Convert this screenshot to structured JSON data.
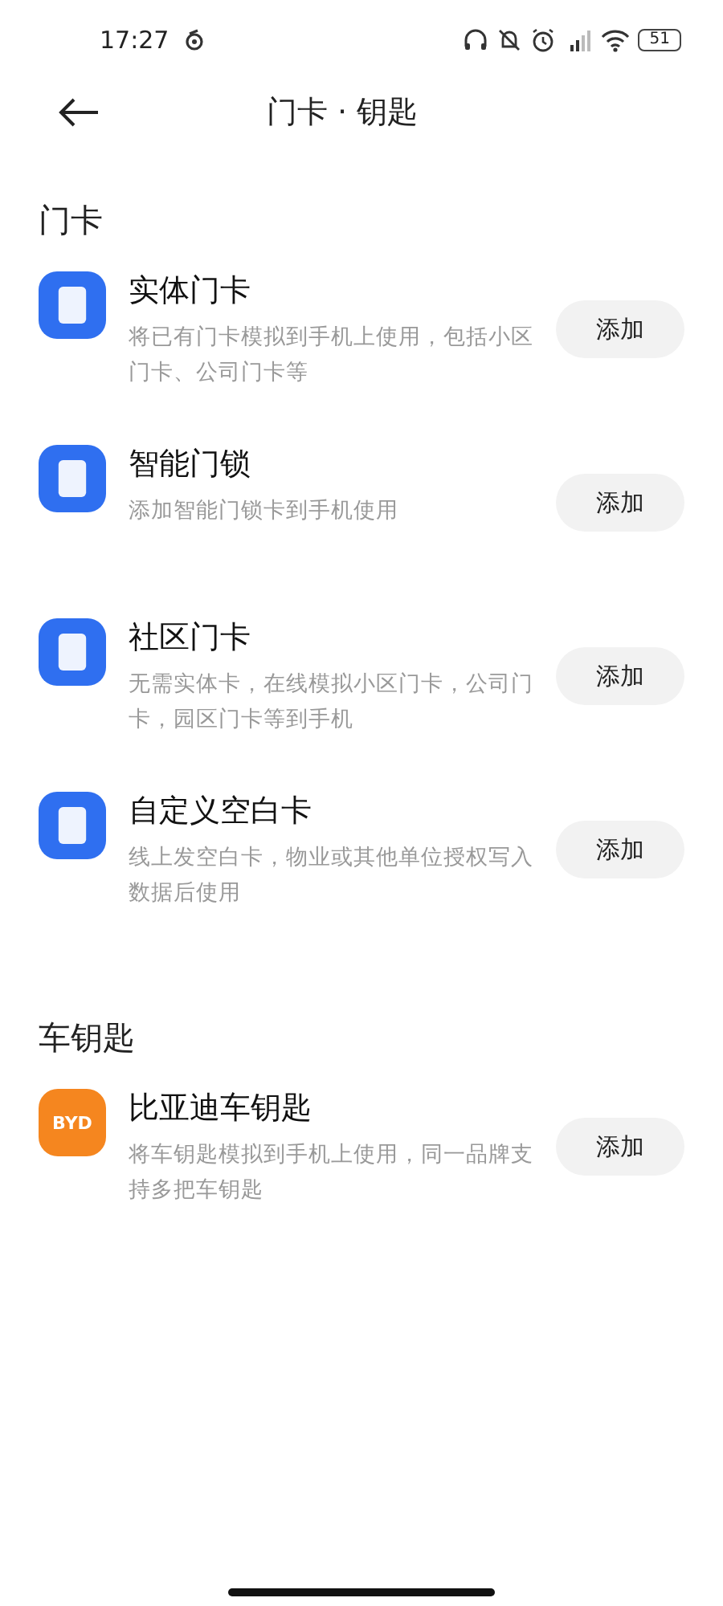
{
  "status_bar": {
    "time": "17:27",
    "battery": "51"
  },
  "header": {
    "title": "门卡 · 钥匙"
  },
  "sections": [
    {
      "title": "门卡",
      "items": [
        {
          "kind": "card",
          "name": "实体门卡",
          "description": "将已有门卡模拟到手机上使用，包括小区门卡、公司门卡等",
          "button": "添加"
        },
        {
          "kind": "card",
          "name": "智能门锁",
          "description": "添加智能门锁卡到手机使用",
          "button": "添加"
        },
        {
          "kind": "card",
          "name": "社区门卡",
          "description": "无需实体卡，在线模拟小区门卡，公司门卡，园区门卡等到手机",
          "button": "添加"
        },
        {
          "kind": "card",
          "name": "自定义空白卡",
          "description": "线上发空白卡，物业或其他单位授权写入数据后使用",
          "button": "添加"
        }
      ]
    },
    {
      "title": "车钥匙",
      "items": [
        {
          "kind": "brand",
          "logo": "BYD",
          "name": "比亚迪车钥匙",
          "description": "将车钥匙模拟到手机上使用，同一品牌支持多把车钥匙",
          "button": "添加"
        }
      ]
    }
  ]
}
